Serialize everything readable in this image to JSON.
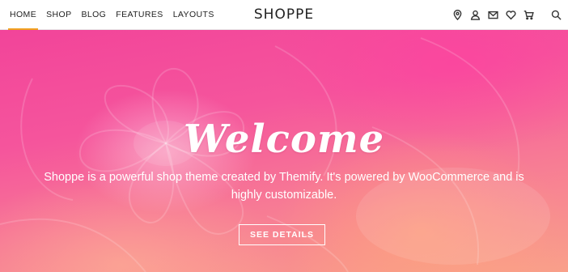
{
  "nav": {
    "items": [
      {
        "label": "HOME",
        "active": true
      },
      {
        "label": "SHOP"
      },
      {
        "label": "BLOG"
      },
      {
        "label": "FEATURES"
      },
      {
        "label": "LAYOUTS"
      }
    ]
  },
  "brand": {
    "logo": "SHOPPE"
  },
  "header_icons": [
    "map-pin-icon",
    "user-icon",
    "mail-icon",
    "heart-icon",
    "cart-icon",
    "search-icon"
  ],
  "hero": {
    "title": "Welcome",
    "description": "Shoppe is a powerful shop theme created by Themify. It's powered by WooCommerce and is highly customizable.",
    "button_label": "SEE DETAILS"
  },
  "colors": {
    "nav_active_underline": "#f0a020",
    "hero_pink": "#f2449a",
    "hero_peach": "#f9a08a"
  }
}
